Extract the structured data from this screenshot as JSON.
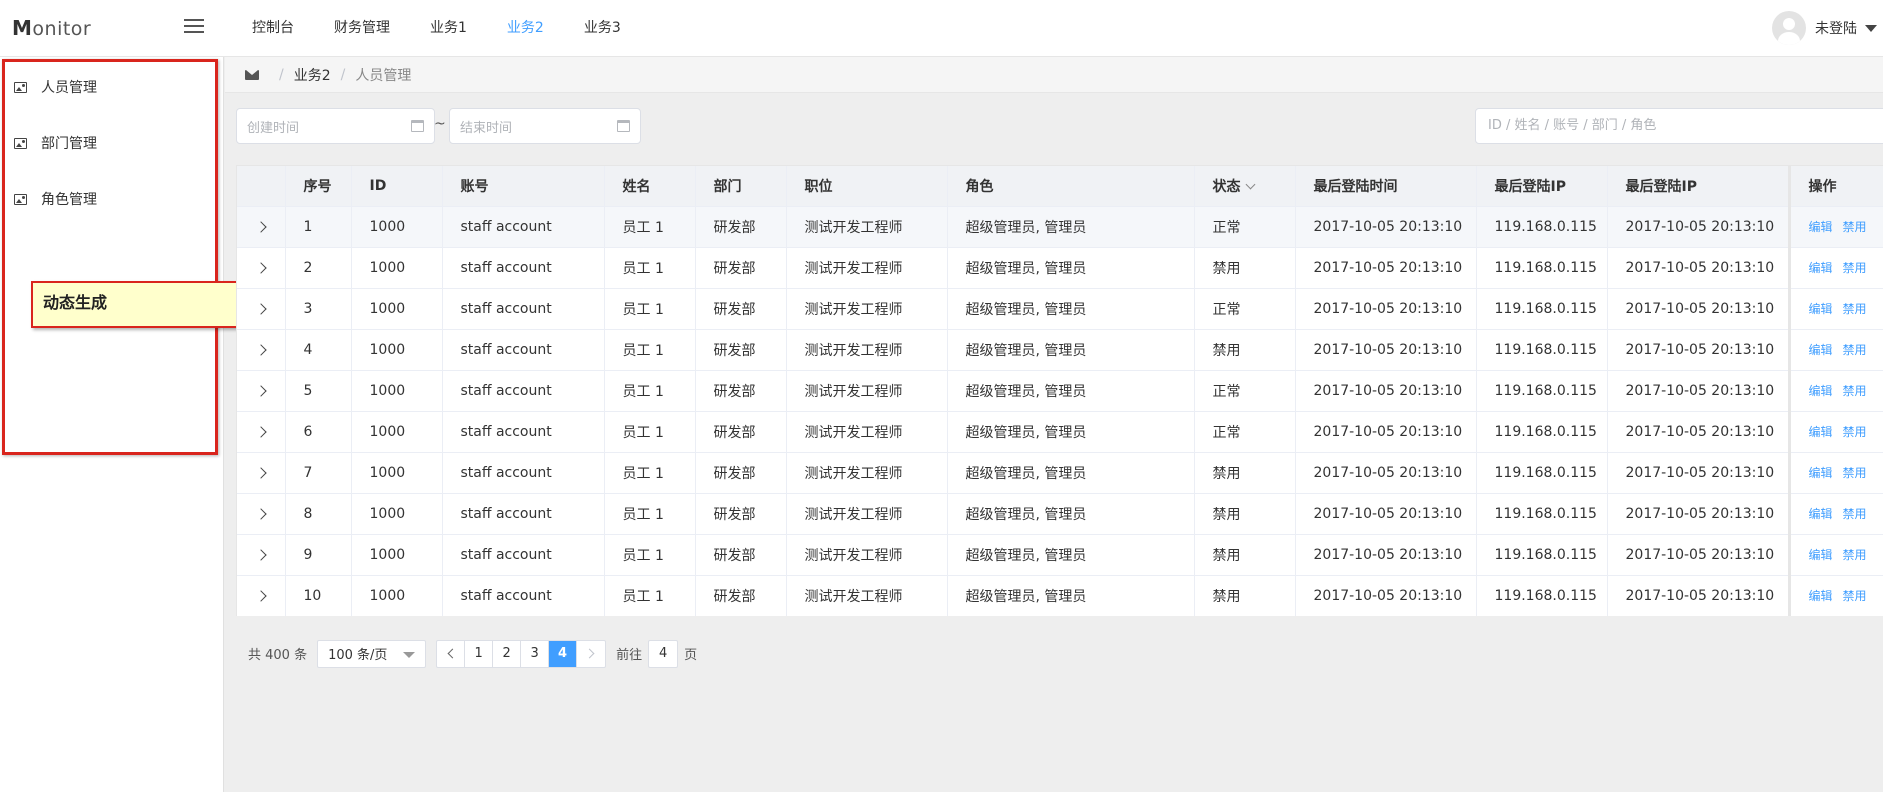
{
  "header": {
    "logo_initial": "M",
    "logo_rest": "onitor",
    "nav": [
      "控制台",
      "财务管理",
      "业务1",
      "业务2",
      "业务3"
    ],
    "active_nav": "业务2",
    "user_name": "未登陆"
  },
  "sidebar": {
    "items": [
      {
        "label": "人员管理",
        "icon": "image-icon"
      },
      {
        "label": "部门管理",
        "icon": "image-icon"
      },
      {
        "label": "角色管理",
        "icon": "image-icon"
      }
    ],
    "annotation": "动态生成"
  },
  "breadcrumb": {
    "icon": "mail-icon",
    "items": [
      "业务2",
      "人员管理"
    ],
    "separator": "/"
  },
  "filters": {
    "start_placeholder": "创建时间",
    "end_placeholder": "结束时间",
    "range_separator": "~",
    "search_placeholder": "ID / 姓名 / 账号 / 部门 / 角色"
  },
  "table": {
    "headers": [
      "",
      "序号",
      "ID",
      "账号",
      "姓名",
      "部门",
      "职位",
      "角色",
      "状态",
      "最后登陆时间",
      "最后登陆IP",
      "最后登陆IP",
      "操作"
    ],
    "rows": [
      {
        "no": "1",
        "id": "1000",
        "account": "staff account",
        "name": "员工 1",
        "dept": "研发部",
        "position": "测试开发工程师",
        "role": "超级管理员, 管理员",
        "status": "正常",
        "login_time": "2017-10-05 20:13:10",
        "login_ip": "119.168.0.115",
        "login_ip2": "2017-10-05 20:13:10"
      },
      {
        "no": "2",
        "id": "1000",
        "account": "staff account",
        "name": "员工 1",
        "dept": "研发部",
        "position": "测试开发工程师",
        "role": "超级管理员, 管理员",
        "status": "禁用",
        "login_time": "2017-10-05 20:13:10",
        "login_ip": "119.168.0.115",
        "login_ip2": "2017-10-05 20:13:10"
      },
      {
        "no": "3",
        "id": "1000",
        "account": "staff account",
        "name": "员工 1",
        "dept": "研发部",
        "position": "测试开发工程师",
        "role": "超级管理员, 管理员",
        "status": "正常",
        "login_time": "2017-10-05 20:13:10",
        "login_ip": "119.168.0.115",
        "login_ip2": "2017-10-05 20:13:10"
      },
      {
        "no": "4",
        "id": "1000",
        "account": "staff account",
        "name": "员工 1",
        "dept": "研发部",
        "position": "测试开发工程师",
        "role": "超级管理员, 管理员",
        "status": "禁用",
        "login_time": "2017-10-05 20:13:10",
        "login_ip": "119.168.0.115",
        "login_ip2": "2017-10-05 20:13:10"
      },
      {
        "no": "5",
        "id": "1000",
        "account": "staff account",
        "name": "员工 1",
        "dept": "研发部",
        "position": "测试开发工程师",
        "role": "超级管理员, 管理员",
        "status": "正常",
        "login_time": "2017-10-05 20:13:10",
        "login_ip": "119.168.0.115",
        "login_ip2": "2017-10-05 20:13:10"
      },
      {
        "no": "6",
        "id": "1000",
        "account": "staff account",
        "name": "员工 1",
        "dept": "研发部",
        "position": "测试开发工程师",
        "role": "超级管理员, 管理员",
        "status": "正常",
        "login_time": "2017-10-05 20:13:10",
        "login_ip": "119.168.0.115",
        "login_ip2": "2017-10-05 20:13:10"
      },
      {
        "no": "7",
        "id": "1000",
        "account": "staff account",
        "name": "员工 1",
        "dept": "研发部",
        "position": "测试开发工程师",
        "role": "超级管理员, 管理员",
        "status": "禁用",
        "login_time": "2017-10-05 20:13:10",
        "login_ip": "119.168.0.115",
        "login_ip2": "2017-10-05 20:13:10"
      },
      {
        "no": "8",
        "id": "1000",
        "account": "staff account",
        "name": "员工 1",
        "dept": "研发部",
        "position": "测试开发工程师",
        "role": "超级管理员, 管理员",
        "status": "禁用",
        "login_time": "2017-10-05 20:13:10",
        "login_ip": "119.168.0.115",
        "login_ip2": "2017-10-05 20:13:10"
      },
      {
        "no": "9",
        "id": "1000",
        "account": "staff account",
        "name": "员工 1",
        "dept": "研发部",
        "position": "测试开发工程师",
        "role": "超级管理员, 管理员",
        "status": "禁用",
        "login_time": "2017-10-05 20:13:10",
        "login_ip": "119.168.0.115",
        "login_ip2": "2017-10-05 20:13:10"
      },
      {
        "no": "10",
        "id": "1000",
        "account": "staff account",
        "name": "员工 1",
        "dept": "研发部",
        "position": "测试开发工程师",
        "role": "超级管理员, 管理员",
        "status": "禁用",
        "login_time": "2017-10-05 20:13:10",
        "login_ip": "119.168.0.115",
        "login_ip2": "2017-10-05 20:13:10"
      }
    ],
    "actions": [
      "编辑",
      "禁用"
    ]
  },
  "pagination": {
    "total_text": "共 400 条",
    "page_size": "100 条/页",
    "pages": [
      "1",
      "2",
      "3",
      "4"
    ],
    "current_page": "4",
    "goto_label": "前往",
    "goto_value": "4",
    "goto_suffix": "页"
  },
  "colors": {
    "accent": "#409eff",
    "annotation_border": "#d9251d",
    "annotation_fill": "#ffffcc"
  }
}
